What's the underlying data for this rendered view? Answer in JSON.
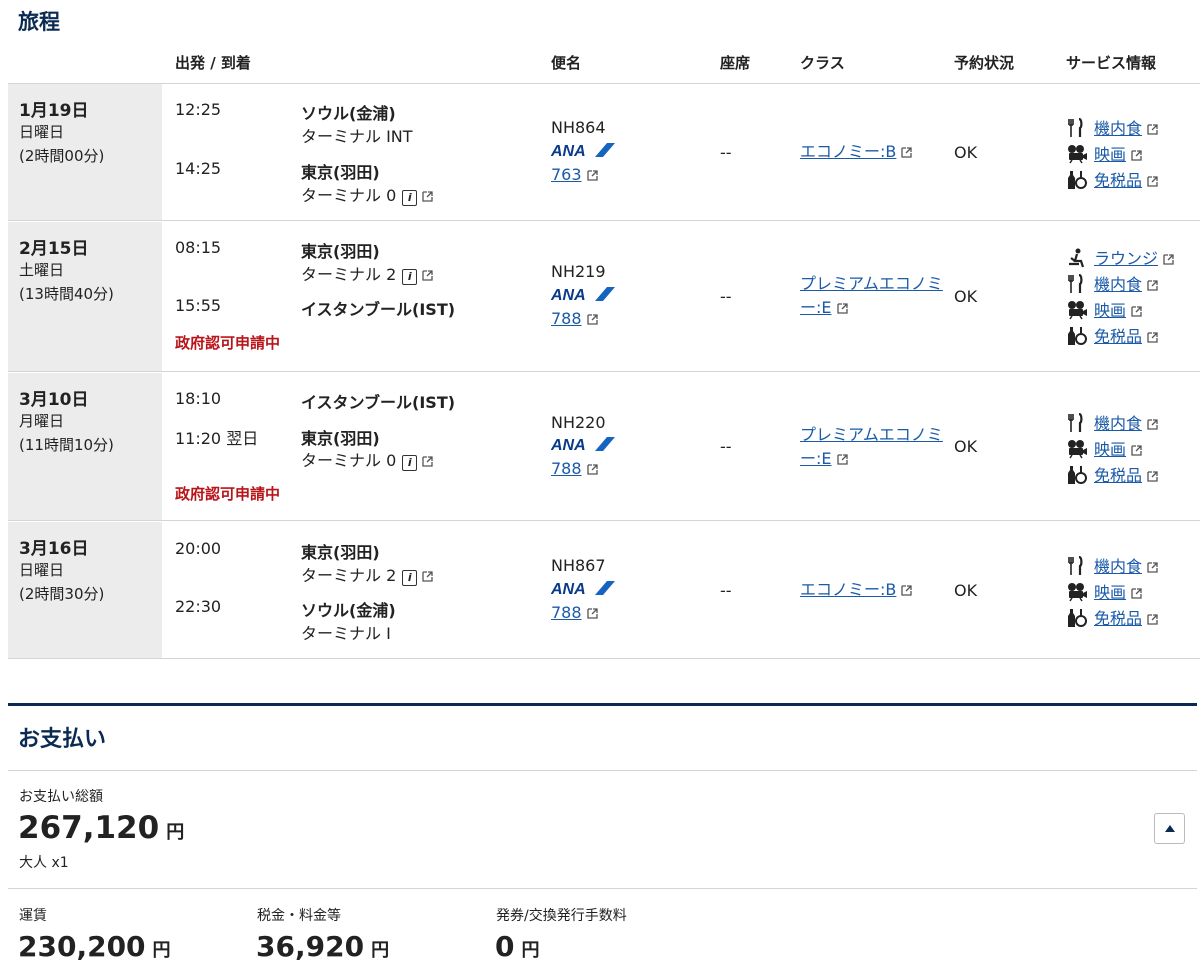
{
  "itinerary": {
    "title": "旅程",
    "headers": {
      "dep_arr": "出発 / 到着",
      "flight": "便名",
      "seat": "座席",
      "class": "クラス",
      "status": "予約状況",
      "service": "サービス情報"
    },
    "segments": [
      {
        "date": "1月19日",
        "weekday": "日曜日",
        "duration": "(2時間00分)",
        "dep_time": "12:25",
        "dep_airport": "ソウル(金浦)",
        "dep_terminal": "ターミナル INT",
        "arr_time": "14:25",
        "arr_airport": "東京(羽田)",
        "arr_terminal": "ターミナル 0",
        "notice": "",
        "flight_no": "NH864",
        "aircraft": "763",
        "seat": "--",
        "class": "エコノミー:B",
        "status": "OK",
        "services": [
          "機内食",
          "映画",
          "免税品"
        ]
      },
      {
        "date": "2月15日",
        "weekday": "土曜日",
        "duration": "(13時間40分)",
        "dep_time": "08:15",
        "dep_airport": "東京(羽田)",
        "dep_terminal": "ターミナル 2",
        "arr_time": "15:55",
        "arr_airport": "イスタンブール(IST)",
        "arr_terminal": "",
        "notice": "政府認可申請中",
        "flight_no": "NH219",
        "aircraft": "788",
        "seat": "--",
        "class": "プレミアムエコノミー:E",
        "status": "OK",
        "services": [
          "ラウンジ",
          "機内食",
          "映画",
          "免税品"
        ]
      },
      {
        "date": "3月10日",
        "weekday": "月曜日",
        "duration": "(11時間10分)",
        "dep_time": "18:10",
        "dep_airport": "イスタンブール(IST)",
        "dep_terminal": "",
        "arr_time": "11:20 翌日",
        "arr_airport": "東京(羽田)",
        "arr_terminal": "ターミナル 0",
        "notice": "政府認可申請中",
        "flight_no": "NH220",
        "aircraft": "788",
        "seat": "--",
        "class": "プレミアムエコノミー:E",
        "status": "OK",
        "services": [
          "機内食",
          "映画",
          "免税品"
        ]
      },
      {
        "date": "3月16日",
        "weekday": "日曜日",
        "duration": "(2時間30分)",
        "dep_time": "20:00",
        "dep_airport": "東京(羽田)",
        "dep_terminal": "ターミナル 2",
        "arr_time": "22:30",
        "arr_airport": "ソウル(金浦)",
        "arr_terminal": "ターミナル I",
        "notice": "",
        "flight_no": "NH867",
        "aircraft": "788",
        "seat": "--",
        "class": "エコノミー:B",
        "status": "OK",
        "services": [
          "機内食",
          "映画",
          "免税品"
        ]
      }
    ]
  },
  "payment": {
    "title": "お支払い",
    "total_label": "お支払い総額",
    "total_amount": "267,120",
    "currency": "円",
    "pax": "大人 x1",
    "breakdown": [
      {
        "label": "運賃",
        "amount": "230,200"
      },
      {
        "label": "税金・料金等",
        "amount": "36,920"
      },
      {
        "label": "発券/交換発行手数料",
        "amount": "0"
      }
    ]
  },
  "colors": {
    "navy": "#0a2a52",
    "link": "#1a5aa8",
    "warning": "#b8141a",
    "date_bg": "#ececec"
  },
  "icons": {
    "external": "external-link-icon",
    "terminal_info": "info-icon",
    "meal": "fork-knife-icon",
    "movie": "film-projector-icon",
    "dutyfree": "bottle-icon",
    "lounge": "seated-person-icon"
  }
}
